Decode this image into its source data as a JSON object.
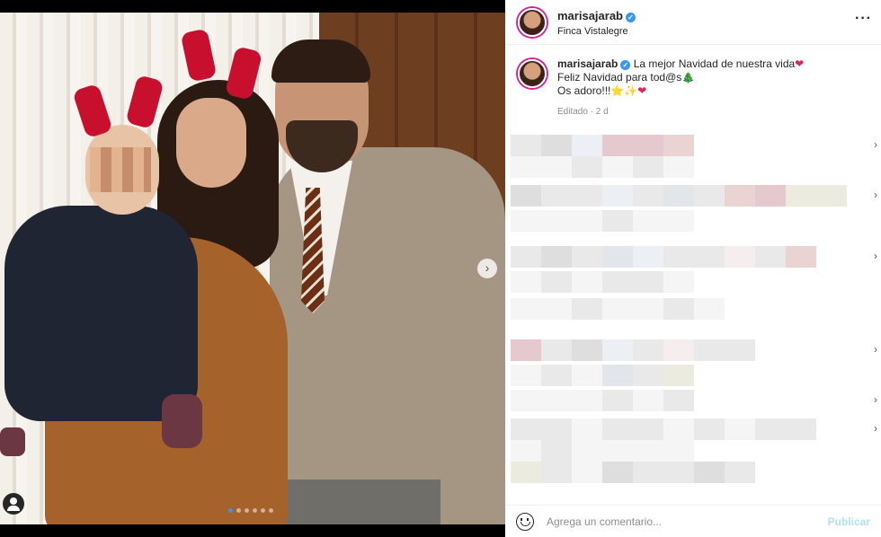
{
  "post": {
    "username": "marisajarab",
    "location": "Finca Vistalegre",
    "more_icon": "more-icon",
    "verified_icon": "verified-icon"
  },
  "caption": {
    "username": "marisajarab",
    "line1": "La mejor Navidad de nuestra vida",
    "line1_emoji": "❤",
    "line2": "Feliz Navidad para tod@s",
    "line2_emoji": "🎄",
    "line3": "Os adoro!!!",
    "line3_emoji_1": "⭐",
    "line3_emoji_2": "✨",
    "line3_emoji_3": "❤",
    "meta": "Editado · 2 d"
  },
  "carousel": {
    "next_icon": "›",
    "slide_count": 6,
    "active_index": 0
  },
  "comment_box": {
    "placeholder": "Agrega un comentario...",
    "publish_label": "Publicar"
  },
  "colors": {
    "accent": "#3897f0",
    "publish_disabled": "#b2dffc",
    "heart": "#e0245e"
  }
}
